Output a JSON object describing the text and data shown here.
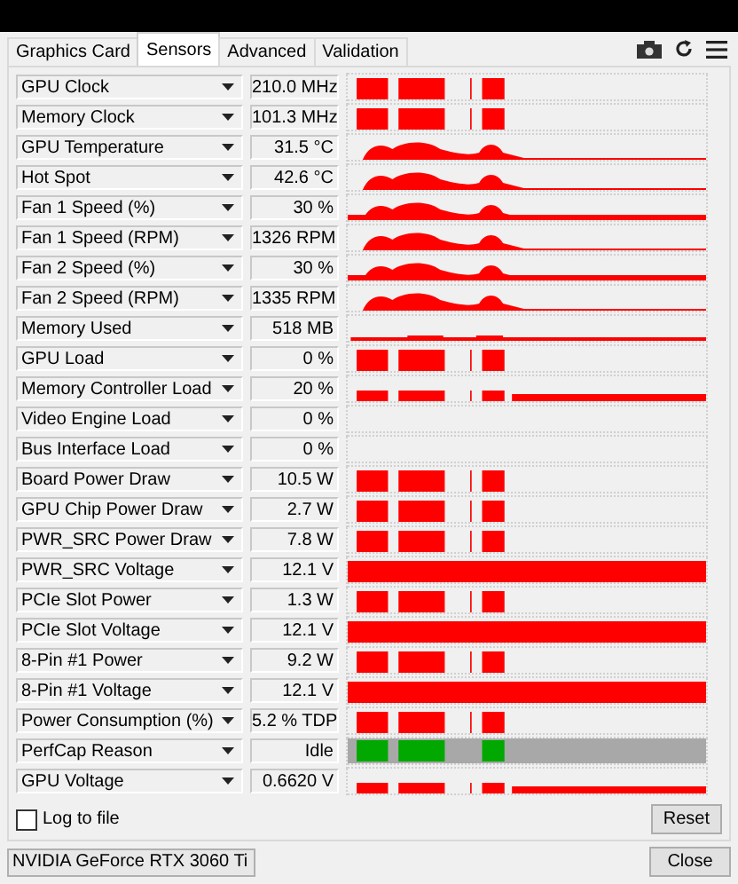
{
  "tabs": [
    {
      "label": "Graphics Card",
      "selected": false
    },
    {
      "label": "Sensors",
      "selected": true
    },
    {
      "label": "Advanced",
      "selected": false
    },
    {
      "label": "Validation",
      "selected": false
    }
  ],
  "sensors": [
    {
      "name": "GPU Clock",
      "value": "210.0 MHz",
      "kind": "burst"
    },
    {
      "name": "Memory Clock",
      "value": "101.3 MHz",
      "kind": "burst"
    },
    {
      "name": "GPU Temperature",
      "value": "31.5 °C",
      "kind": "wave"
    },
    {
      "name": "Hot Spot",
      "value": "42.6 °C",
      "kind": "wave"
    },
    {
      "name": "Fan 1 Speed (%)",
      "value": "30 %",
      "kind": "wavefull"
    },
    {
      "name": "Fan 1 Speed (RPM)",
      "value": "1326 RPM",
      "kind": "wave"
    },
    {
      "name": "Fan 2 Speed (%)",
      "value": "30 %",
      "kind": "wavefull"
    },
    {
      "name": "Fan 2 Speed (RPM)",
      "value": "1335 RPM",
      "kind": "wave"
    },
    {
      "name": "Memory Used",
      "value": "518 MB",
      "kind": "low"
    },
    {
      "name": "GPU Load",
      "value": "0 %",
      "kind": "burst"
    },
    {
      "name": "Memory Controller Load",
      "value": "20 %",
      "kind": "lowburst"
    },
    {
      "name": "Video Engine Load",
      "value": "0 %",
      "kind": "none"
    },
    {
      "name": "Bus Interface Load",
      "value": "0 %",
      "kind": "none"
    },
    {
      "name": "Board Power Draw",
      "value": "10.5 W",
      "kind": "burst"
    },
    {
      "name": "GPU Chip Power Draw",
      "value": "2.7 W",
      "kind": "burst"
    },
    {
      "name": "PWR_SRC Power Draw",
      "value": "7.8 W",
      "kind": "burst"
    },
    {
      "name": "PWR_SRC Voltage",
      "value": "12.1 V",
      "kind": "full"
    },
    {
      "name": "PCIe Slot Power",
      "value": "1.3 W",
      "kind": "burst"
    },
    {
      "name": "PCIe Slot Voltage",
      "value": "12.1 V",
      "kind": "full"
    },
    {
      "name": "8-Pin #1 Power",
      "value": "9.2 W",
      "kind": "burst"
    },
    {
      "name": "8-Pin #1 Voltage",
      "value": "12.1 V",
      "kind": "full"
    },
    {
      "name": "Power Consumption (%)",
      "value": "5.2 % TDP",
      "kind": "burst"
    },
    {
      "name": "PerfCap Reason",
      "value": "Idle",
      "kind": "perfcap"
    },
    {
      "name": "GPU Voltage",
      "value": "0.6620 V",
      "kind": "lowburst"
    }
  ],
  "log_to_file": {
    "label": "Log to file",
    "checked": false
  },
  "reset_button": "Reset",
  "gpu_select": {
    "value": "NVIDIA GeForce RTX 3060 Ti"
  },
  "close_button": "Close"
}
